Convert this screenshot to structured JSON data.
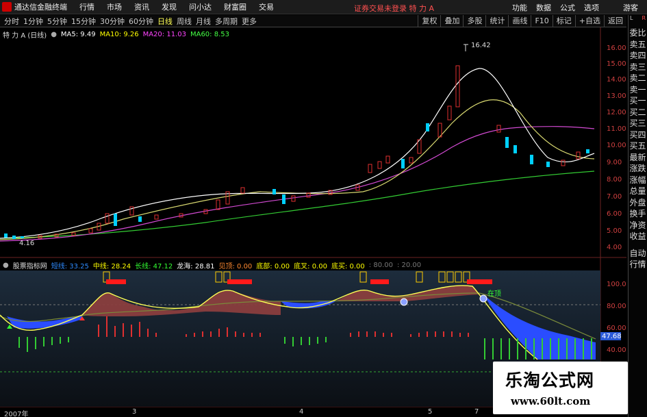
{
  "menubar": {
    "app_title": "通达信金融终端",
    "items": [
      "行情",
      "市场",
      "资讯",
      "发现",
      "问小达",
      "财富圈",
      "交易"
    ],
    "status": "证券交易未登录  特 力 A",
    "right_items": [
      "功能",
      "数据",
      "公式",
      "选项"
    ],
    "guest": "游客"
  },
  "toolbar": {
    "periods": [
      "分时",
      "1分钟",
      "5分钟",
      "15分钟",
      "30分钟",
      "60分钟",
      "日线",
      "周线",
      "月线",
      "多周期",
      "更多"
    ],
    "active_period": "日线",
    "right_items": [
      "复权",
      "叠加",
      "多股",
      "统计",
      "画线",
      "F10",
      "标记",
      "+自选",
      "返回"
    ]
  },
  "price_chart": {
    "legend_title": "特 力 A (日线)",
    "ma": [
      {
        "label": "MA5: 9.49",
        "color": "#ffffff"
      },
      {
        "label": "MA10: 9.26",
        "color": "#ffff00"
      },
      {
        "label": "MA20: 11.03",
        "color": "#ff44ff"
      },
      {
        "label": "MA60: 8.53",
        "color": "#44ff44"
      }
    ],
    "high_label": "16.42",
    "low_label": "4.16",
    "y_ticks": [
      "16.00",
      "15.00",
      "14.00",
      "13.00",
      "12.00",
      "11.00",
      "10.00",
      "9.00",
      "8.00",
      "7.00",
      "6.00",
      "5.00",
      "4.00"
    ]
  },
  "indicator": {
    "title": "股票指标网",
    "values": [
      {
        "label": "短线: 33.25",
        "color": "#2e8bff"
      },
      {
        "label": "中线: 28.24",
        "color": "#ffff00"
      },
      {
        "label": "长线: 47.12",
        "color": "#33ff33"
      },
      {
        "label": "龙海: 28.81",
        "color": "#ffffff"
      },
      {
        "label": "见顶: 0.00",
        "color": "#ff8a30"
      },
      {
        "label": "底部: 0.00",
        "color": "#ffff00"
      },
      {
        "label": "底叉: 0.00",
        "color": "#ffff00"
      },
      {
        "label": "底买: 0.00",
        "color": "#ffff00"
      },
      {
        "label": ": 80.00",
        "color": "#777777"
      },
      {
        "label": ": 20.00",
        "color": "#777777"
      }
    ],
    "y_ticks": [
      "100.0",
      "80.00",
      "60.00",
      "40.00"
    ],
    "current_value": "47.68",
    "annotation": "在顶"
  },
  "sidepanel": {
    "top_left": "L",
    "top_right": "R",
    "items": [
      "委比",
      "卖五",
      "卖四",
      "卖三",
      "卖二",
      "卖一",
      "买一",
      "买二",
      "买三",
      "买四",
      "买五",
      "最新",
      "涨跌",
      "涨幅",
      "总量",
      "外盘",
      "换手",
      "净资",
      "收益"
    ],
    "bottom_items": [
      "自动",
      "行情"
    ]
  },
  "dates": [
    "2007年",
    "3",
    "4",
    "5",
    "7"
  ],
  "watermark": {
    "title": "乐淘公式网",
    "url": "www.60lt.com"
  }
}
